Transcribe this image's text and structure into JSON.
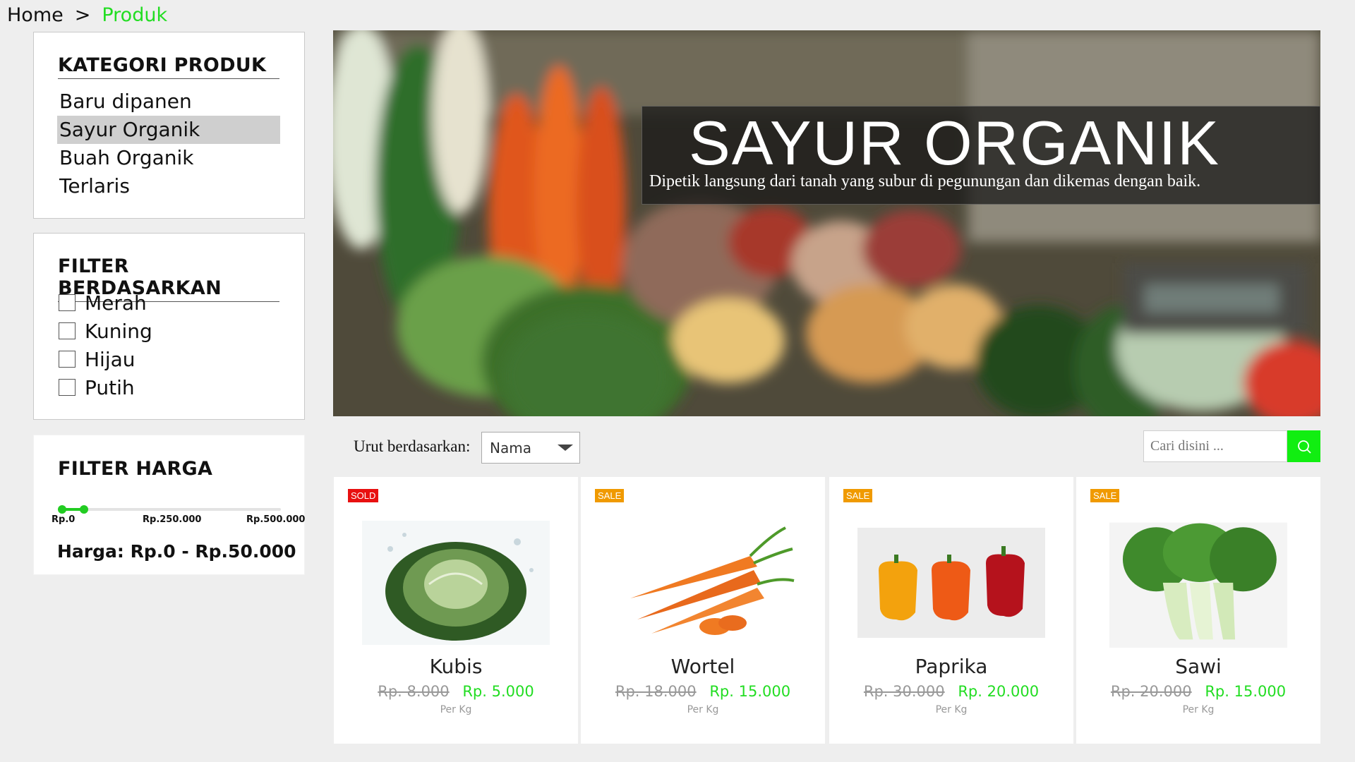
{
  "breadcrumb": {
    "home": "Home",
    "separator": ">",
    "current": "Produk"
  },
  "categories": {
    "title": "KATEGORI PRODUK",
    "items": [
      {
        "label": "Baru dipanen"
      },
      {
        "label": "Sayur Organik",
        "active": true
      },
      {
        "label": "Buah Organik"
      },
      {
        "label": "Terlaris"
      }
    ]
  },
  "filters": {
    "title": "FILTER BERDASARKAN",
    "options": [
      {
        "label": "Merah",
        "checked": false
      },
      {
        "label": "Kuning",
        "checked": false
      },
      {
        "label": "Hijau",
        "checked": false
      },
      {
        "label": "Putih",
        "checked": false
      }
    ]
  },
  "price_filter": {
    "title": "FILTER HARGA",
    "ticks": [
      "Rp.0",
      "Rp.250.000",
      "Rp.500.000"
    ],
    "range_min": 0,
    "range_max": 50000,
    "scale_max": 500000,
    "summary": "Harga: Rp.0 - Rp.50.000",
    "accent": "#22cc22"
  },
  "hero": {
    "title": "SAYUR ORGANIK",
    "subtitle": "Dipetik langsung dari tanah yang subur di pegunungan dan dikemas dengan baik."
  },
  "toolbar": {
    "sort_label": "Urut berdasarkan:",
    "sort_value": "Nama",
    "search_placeholder": "Cari disini ...",
    "search_color": "#11ee11"
  },
  "products": [
    {
      "name": "Kubis",
      "badge": "SOLD",
      "old_price": "Rp. 8.000",
      "price": "Rp. 5.000",
      "unit": "Per Kg",
      "image_icon": "cabbage-image"
    },
    {
      "name": "Wortel",
      "badge": "SALE",
      "old_price": "Rp. 18.000",
      "price": "Rp. 15.000",
      "unit": "Per Kg",
      "image_icon": "carrot-image"
    },
    {
      "name": "Paprika",
      "badge": "SALE",
      "old_price": "Rp. 30.000",
      "price": "Rp. 20.000",
      "unit": "Per Kg",
      "image_icon": "paprika-image"
    },
    {
      "name": "Sawi",
      "badge": "SALE",
      "old_price": "Rp. 20.000",
      "price": "Rp. 15.000",
      "unit": "Per Kg",
      "image_icon": "bokchoy-image"
    }
  ],
  "colors": {
    "accent_green": "#22dd22",
    "sold_badge": "#e81010",
    "sale_badge": "#f09a00"
  }
}
